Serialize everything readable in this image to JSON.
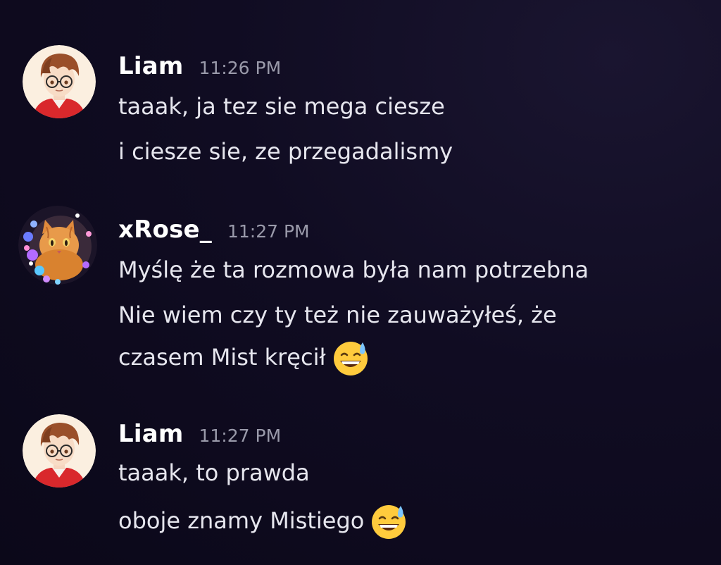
{
  "colors": {
    "background": "#0b0819",
    "username": "#ffffff",
    "timestamp": "#9a9aaa",
    "message_text": "#e6e6ee"
  },
  "messages": [
    {
      "author": "Liam",
      "avatar_icon": "anime-boy-glasses-avatar",
      "time": "11:26 PM",
      "lines": [
        "taaak, ja tez sie mega ciesze",
        "i ciesze sie, ze przegadalismy"
      ]
    },
    {
      "author": "xRose_",
      "avatar_icon": "orange-cat-flowers-avatar",
      "time": "11:27 PM",
      "lines": [
        "Myślę że ta rozmowa była nam potrzebna",
        "Nie wiem czy ty też nie zauważyłeś, że",
        "czasem Mist kręcił"
      ],
      "emoji": "grinning-face-with-sweat-emoji"
    },
    {
      "author": "Liam",
      "avatar_icon": "anime-boy-glasses-avatar",
      "time": "11:27 PM",
      "lines": [
        "taaak, to prawda",
        "oboje znamy Mistiego"
      ],
      "emoji": "grinning-face-with-sweat-emoji"
    }
  ]
}
